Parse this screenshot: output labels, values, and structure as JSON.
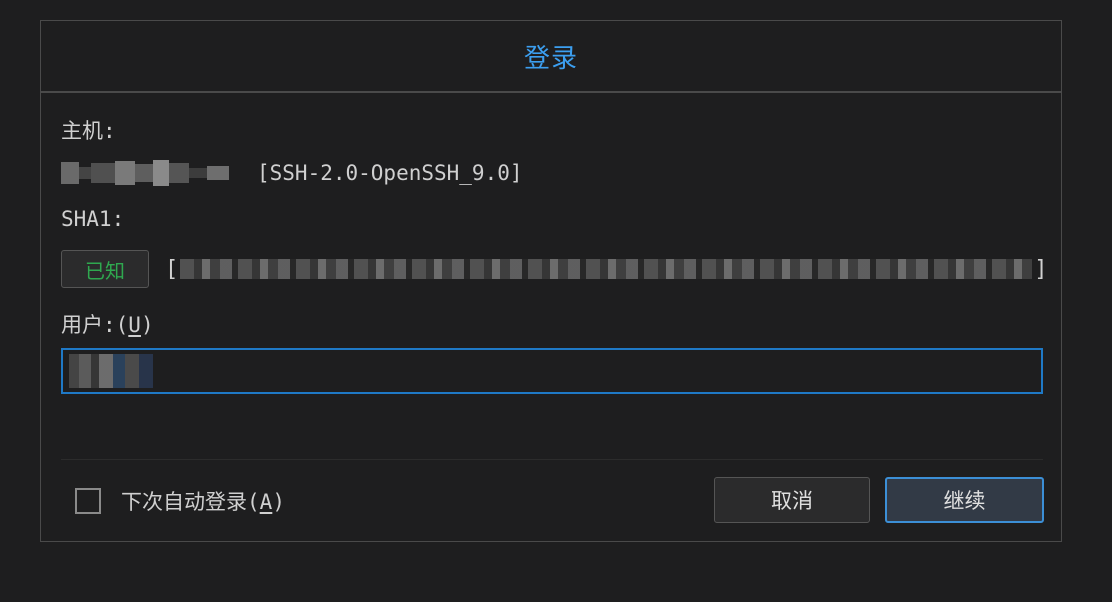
{
  "dialog": {
    "title": "登录"
  },
  "host": {
    "label": "主机:",
    "version": "[SSH-2.0-OpenSSH_9.0]"
  },
  "sha1": {
    "label": "SHA1:",
    "status_button": "已知",
    "status_color": "#2fa84f",
    "bracket_open": "[",
    "bracket_close": "]"
  },
  "user": {
    "label_prefix": "用户:(",
    "label_mnemonic": "U",
    "label_suffix": ")"
  },
  "auto_login": {
    "checked": false,
    "label_prefix": "下次自动登录(",
    "label_mnemonic": "A",
    "label_suffix": ")"
  },
  "buttons": {
    "cancel": "取消",
    "continue": "继续"
  },
  "colors": {
    "accent": "#3c9ff0",
    "focus_border": "#1f79c6",
    "known_green": "#2fa84f"
  }
}
